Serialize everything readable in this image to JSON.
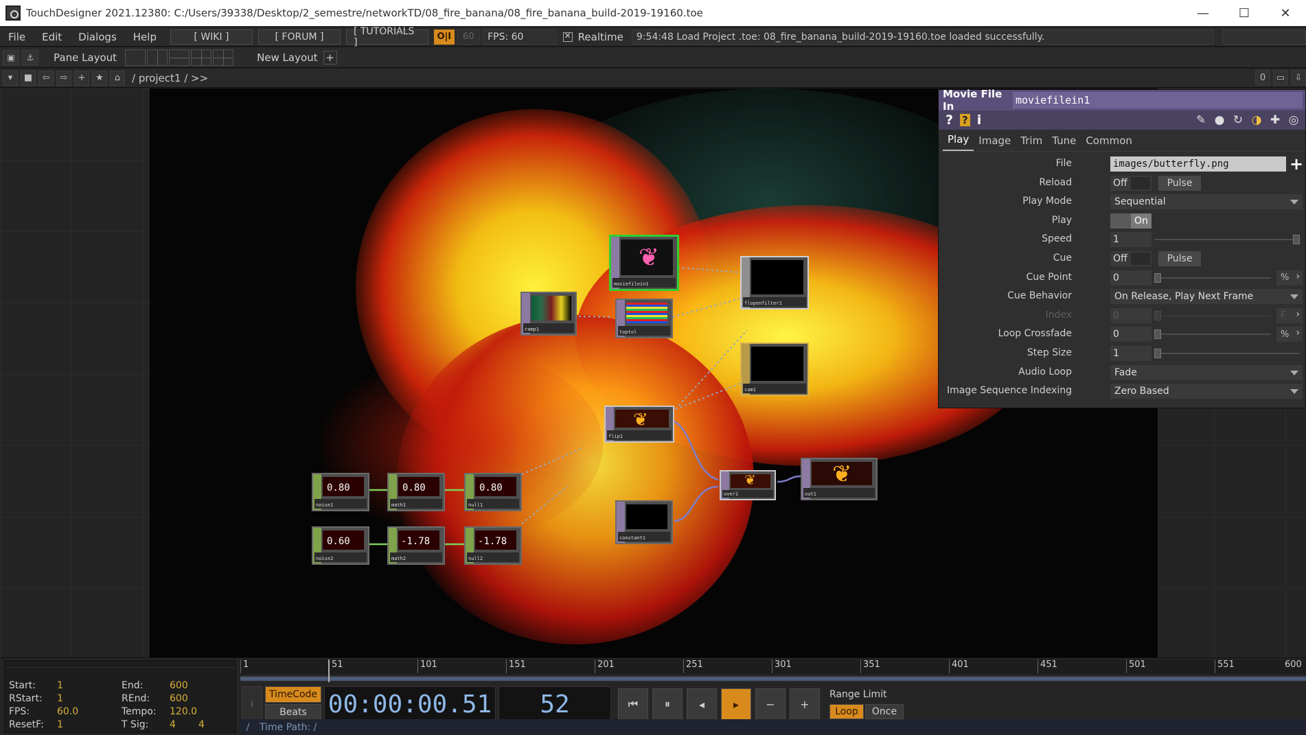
{
  "window": {
    "title": "TouchDesigner 2021.12380: C:/Users/39338/Desktop/2_semestre/networkTD/08_fire_banana/08_fire_banana_build-2019-19160.toe",
    "minimize": "—",
    "maximize": "☐",
    "close": "✕"
  },
  "menu": {
    "items": [
      "File",
      "Edit",
      "Dialogs",
      "Help"
    ],
    "wiki": "[ WIKI ]",
    "forum": "[ FORUM ]",
    "tutorials": "[ TUTORIALS ]",
    "oi": "O|I",
    "fps_cap": "60",
    "fps": "FPS:  60",
    "realtime": "Realtime",
    "status": "9:54:48 Load Project .toe: 08_fire_banana_build-2019-19160.toe loaded successfully."
  },
  "panebar": {
    "pane_layout": "Pane Layout",
    "new_layout": "New Layout",
    "plus": "+"
  },
  "pathbar": {
    "path": "/ project1 / >>",
    "right_0": "0"
  },
  "nodes": {
    "moviefilein1": "moviefilein1",
    "ramp1": "ramp1",
    "toptol": "toptol",
    "flopenfilter1": "flopenfilter1",
    "cam1": "cam1",
    "flip1": "flip1",
    "over1": "over1",
    "out1": "out1",
    "constant1": "constant1",
    "noise1": "noise1",
    "math1": "math1",
    "null1": "null1",
    "noise2": "noise2",
    "math2": "math2",
    "null2": "null2",
    "chop_r1": [
      "0.80",
      "0.80",
      "0.80"
    ],
    "chop_r2": [
      "0.60",
      "-1.78",
      "-1.78"
    ]
  },
  "params": {
    "op_type": "Movie File In",
    "op_name": "moviefilein1",
    "tabs": [
      "Play",
      "Image",
      "Trim",
      "Tune",
      "Common"
    ],
    "file_label": "File",
    "file_value": "images/butterfly.png",
    "reload_label": "Reload",
    "reload_value": "Off",
    "pulse": "Pulse",
    "playmode_label": "Play Mode",
    "playmode_value": "Sequential",
    "play_label": "Play",
    "play_value": "On",
    "speed_label": "Speed",
    "speed_value": "1",
    "cue_label": "Cue",
    "cue_value": "Off",
    "cuepoint_label": "Cue Point",
    "cuepoint_value": "0",
    "unit": "%",
    "cuebehavior_label": "Cue Behavior",
    "cuebehavior_value": "On Release, Play Next Frame",
    "index_label": "Index",
    "index_value": "0",
    "index_unit": "F",
    "loopcrossfade_label": "Loop Crossfade",
    "loopcrossfade_value": "0",
    "stepsize_label": "Step Size",
    "stepsize_value": "1",
    "audioloop_label": "Audio Loop",
    "audioloop_value": "Fade",
    "imgseq_label": "Image Sequence Indexing",
    "imgseq_value": "Zero Based"
  },
  "timeline": {
    "info": {
      "start_k": "Start:",
      "start_v": "1",
      "end_k": "End:",
      "end_v": "600",
      "rstart_k": "RStart:",
      "rstart_v": "1",
      "rend_k": "REnd:",
      "rend_v": "600",
      "fps_k": "FPS:",
      "fps_v": "60.0",
      "tempo_k": "Tempo:",
      "tempo_v": "120.0",
      "resetf_k": "ResetF:",
      "resetf_v": "1",
      "tsig_k": "T Sig:",
      "tsig_v1": "4",
      "tsig_v2": "4"
    },
    "ticks": [
      "1",
      "51",
      "101",
      "151",
      "201",
      "251",
      "301",
      "351",
      "401",
      "451",
      "501",
      "551",
      "600"
    ],
    "timecode_btn": "TimeCode",
    "beats_btn": "Beats",
    "timecode": "00:00:00.51",
    "frame": "52",
    "range_limit": "Range Limit",
    "loop": "Loop",
    "once": "Once",
    "time_path": "Time Path: /"
  },
  "colors": {
    "accent": "#d88a1c",
    "param_header": "#5a4f7a",
    "selected_node": "#2fd02f",
    "timecode_text": "#8fb8e8"
  }
}
